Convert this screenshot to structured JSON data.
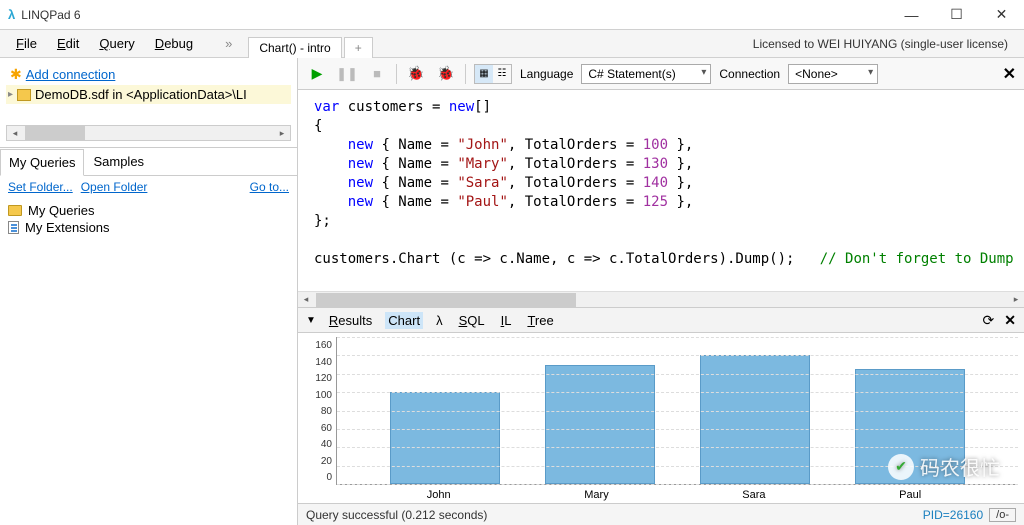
{
  "window": {
    "title": "LINQPad 6"
  },
  "menu": {
    "file": "File",
    "edit": "Edit",
    "query": "Query",
    "debug": "Debug"
  },
  "tabs": {
    "active": "Chart() - intro",
    "plus": "+"
  },
  "license": "Licensed to WEI HUIYANG (single-user license)",
  "sidebar": {
    "add_connection": "Add connection",
    "db_label": "DemoDB.sdf in <ApplicationData>\\LI",
    "tabs": {
      "my_queries": "My Queries",
      "samples": "Samples"
    },
    "links": {
      "set_folder": "Set Folder...",
      "open_folder": "Open Folder",
      "goto": "Go to..."
    },
    "tree": {
      "my_queries": "My Queries",
      "my_extensions": "My Extensions"
    }
  },
  "toolbar": {
    "language_label": "Language",
    "language_value": "C# Statement(s)",
    "connection_label": "Connection",
    "connection_value": "<None>"
  },
  "code": {
    "l1a": "var",
    "l1b": " customers = ",
    "l1c": "new",
    "l1d": "[]",
    "l2": "{",
    "l3a": "    ",
    "l3b": "new",
    "l3c": " { Name = ",
    "l3d": "\"John\"",
    "l3e": ", TotalOrders = ",
    "l3f": "100",
    "l3g": " },",
    "l4a": "    ",
    "l4b": "new",
    "l4c": " { Name = ",
    "l4d": "\"Mary\"",
    "l4e": ", TotalOrders = ",
    "l4f": "130",
    "l4g": " },",
    "l5a": "    ",
    "l5b": "new",
    "l5c": " { Name = ",
    "l5d": "\"Sara\"",
    "l5e": ", TotalOrders = ",
    "l5f": "140",
    "l5g": " },",
    "l6a": "    ",
    "l6b": "new",
    "l6c": " { Name = ",
    "l6d": "\"Paul\"",
    "l6e": ", TotalOrders = ",
    "l6f": "125",
    "l6g": " },",
    "l7": "};",
    "l8": "",
    "l9a": "customers.Chart (c => c.Name, c => c.TotalOrders).Dump();   ",
    "l9b": "// Don't forget to Dump"
  },
  "results": {
    "tabs": {
      "results": "Results",
      "chart": "Chart",
      "lambda": "λ",
      "sql": "SQL",
      "il": "IL",
      "tree": "Tree"
    }
  },
  "chart_data": {
    "type": "bar",
    "categories": [
      "John",
      "Mary",
      "Sara",
      "Paul"
    ],
    "values": [
      100,
      130,
      140,
      125
    ],
    "ylim": [
      0,
      160
    ],
    "yticks": [
      160,
      140,
      120,
      100,
      80,
      60,
      40,
      20,
      0
    ],
    "title": "",
    "xlabel": "",
    "ylabel": ""
  },
  "status": {
    "text": "Query successful  (0.212 seconds)",
    "pid": "PID=26160",
    "opt": "/o-"
  },
  "watermark": "码农很忙"
}
